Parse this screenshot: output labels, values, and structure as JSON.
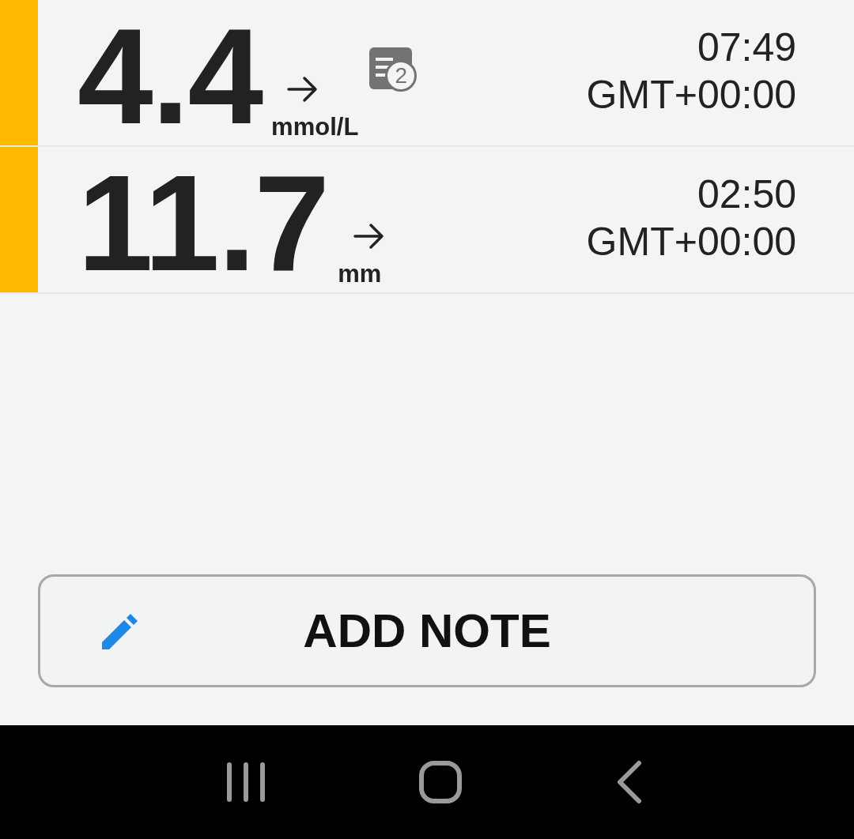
{
  "readings": [
    {
      "value": "4.4",
      "unit": "mmol/L",
      "notes": "2",
      "time": "07:49",
      "timezone": "GMT+00:00",
      "color": "#ffb900"
    },
    {
      "value": "11.7",
      "unit": "mm",
      "time": "02:50",
      "timezone": "GMT+00:00",
      "color": "#ffb900"
    }
  ],
  "add_note_button": {
    "label": "ADD NOTE"
  }
}
